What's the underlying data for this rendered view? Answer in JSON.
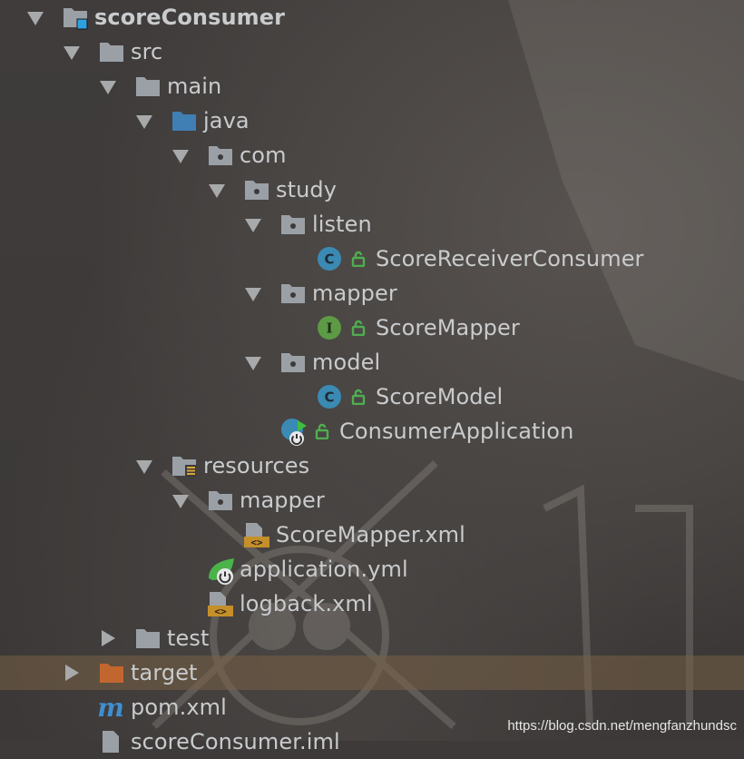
{
  "tree": {
    "rows": [
      {
        "label": "scoreConsumer",
        "icon": "module-folder-icon",
        "expanded": true
      },
      {
        "label": "src",
        "icon": "folder-icon",
        "expanded": true
      },
      {
        "label": "main",
        "icon": "folder-icon",
        "expanded": true
      },
      {
        "label": "java",
        "icon": "source-root-folder-icon",
        "expanded": true
      },
      {
        "label": "com",
        "icon": "package-icon",
        "expanded": true
      },
      {
        "label": "study",
        "icon": "package-icon",
        "expanded": true
      },
      {
        "label": "listen",
        "icon": "package-icon",
        "expanded": true
      },
      {
        "label": "ScoreReceiverConsumer",
        "icon": "class-icon"
      },
      {
        "label": "mapper",
        "icon": "package-icon",
        "expanded": true
      },
      {
        "label": "ScoreMapper",
        "icon": "interface-icon"
      },
      {
        "label": "model",
        "icon": "package-icon",
        "expanded": true
      },
      {
        "label": "ScoreModel",
        "icon": "class-icon"
      },
      {
        "label": "ConsumerApplication",
        "icon": "spring-boot-class-icon"
      },
      {
        "label": "resources",
        "icon": "resources-folder-icon",
        "expanded": true
      },
      {
        "label": "mapper",
        "icon": "package-icon",
        "expanded": true
      },
      {
        "label": "ScoreMapper.xml",
        "icon": "xml-file-icon"
      },
      {
        "label": "application.yml",
        "icon": "spring-yml-icon"
      },
      {
        "label": "logback.xml",
        "icon": "xml-file-icon"
      },
      {
        "label": "test",
        "icon": "folder-icon",
        "expanded": false
      },
      {
        "label": "target",
        "icon": "excluded-folder-icon",
        "expanded": false,
        "selected": true
      },
      {
        "label": "pom.xml",
        "icon": "maven-icon"
      },
      {
        "label": "scoreConsumer.iml",
        "icon": "iml-file-icon"
      }
    ]
  },
  "watermark": "https://blog.csdn.net/mengfanzhundsc",
  "colors": {
    "text": "#c9cbcd",
    "folder": "#9aa0a6",
    "source_folder": "#3f7fb3",
    "class_badge": "#3a8ab3",
    "interface_badge": "#5d9a45",
    "excluded_folder": "#c2662f",
    "xml_badge": "#c58f2a",
    "selection": "#786046"
  }
}
